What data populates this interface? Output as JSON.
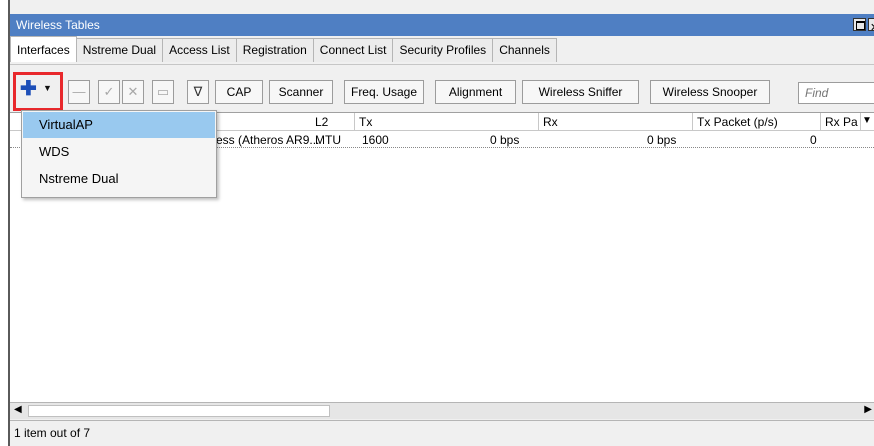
{
  "window": {
    "title": "Wireless Tables"
  },
  "tabs": [
    {
      "label": "Interfaces",
      "active": true
    },
    {
      "label": "Nstreme Dual"
    },
    {
      "label": "Access List"
    },
    {
      "label": "Registration"
    },
    {
      "label": "Connect List"
    },
    {
      "label": "Security Profiles"
    },
    {
      "label": "Channels"
    }
  ],
  "toolbar": {
    "add_icon": "plus-icon",
    "cap_label": "CAP",
    "scanner_label": "Scanner",
    "freq_label": "Freq. Usage",
    "alignment_label": "Alignment",
    "sniffer_label": "Wireless Sniffer",
    "snooper_label": "Wireless Snooper",
    "find_placeholder": "Find"
  },
  "add_menu": {
    "items": [
      "VirtualAP",
      "WDS",
      "Nstreme Dual"
    ],
    "highlighted": "VirtualAP"
  },
  "table": {
    "columns": [
      "L2 MTU",
      "Tx",
      "Rx",
      "Tx Packet (p/s)",
      "Rx Pa"
    ],
    "row": {
      "type": "ess (Atheros AR9...",
      "l2mtu": "1600",
      "tx": "0 bps",
      "rx": "0 bps",
      "tx_packet": "0"
    }
  },
  "status": {
    "text": "1 item out of 7"
  },
  "colors": {
    "titlebar": "#4f7fc3",
    "highlight": "#99c9ef",
    "add_outline": "#e8282c",
    "plus_icon": "#1d4fb8"
  }
}
